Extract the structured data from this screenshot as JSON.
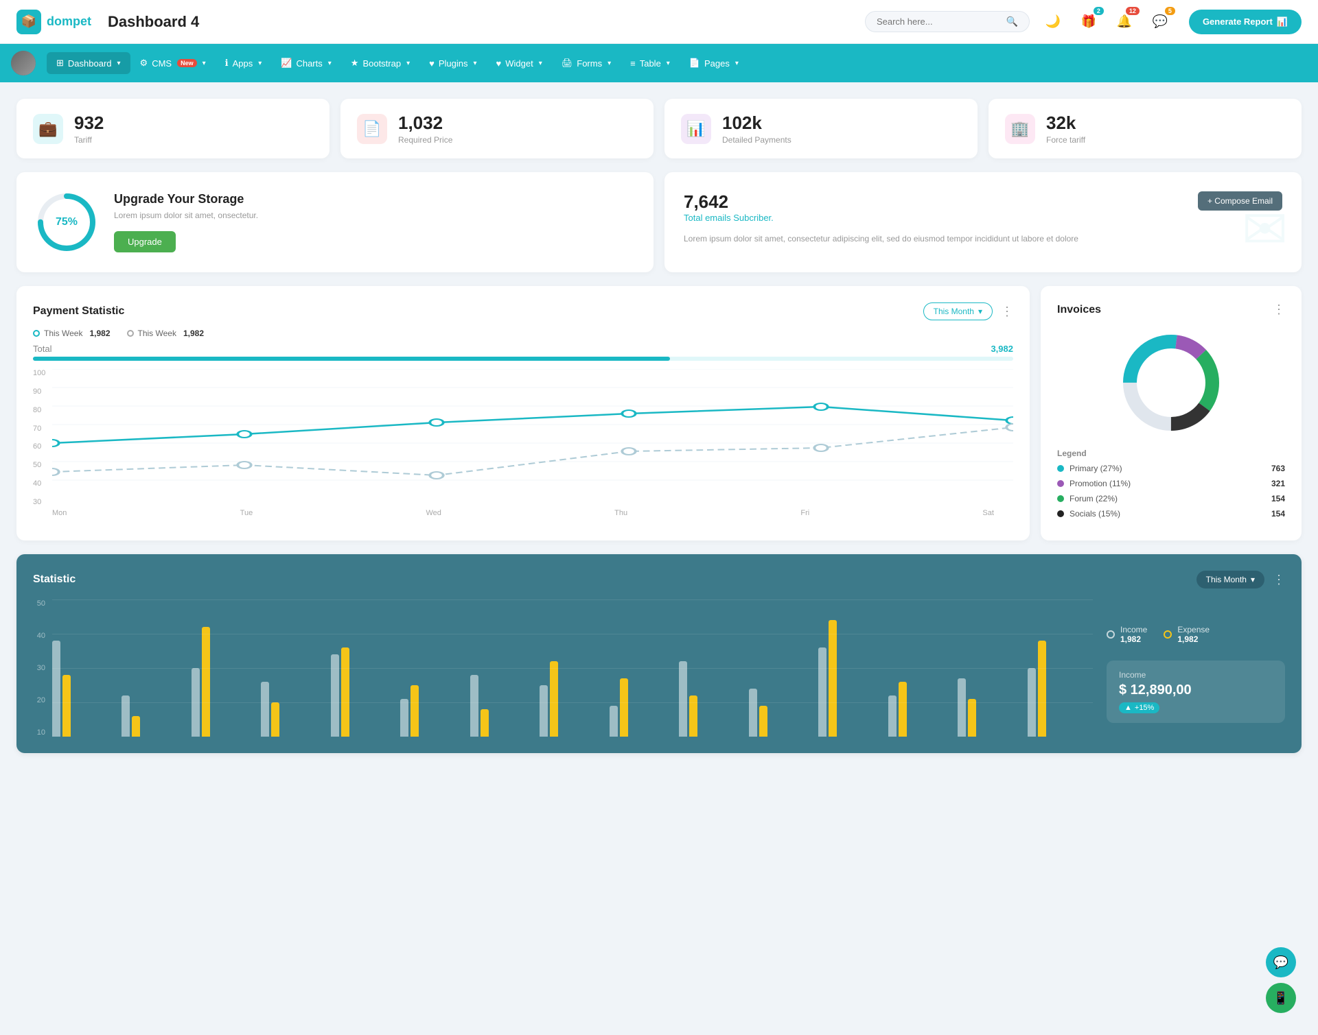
{
  "header": {
    "logo_text": "dompet",
    "page_title": "Dashboard 4",
    "search_placeholder": "Search here...",
    "generate_btn": "Generate Report",
    "icons": {
      "gift_badge": "2",
      "bell_badge": "12",
      "chat_badge": "5"
    }
  },
  "nav": {
    "items": [
      {
        "label": "Dashboard",
        "active": true,
        "has_dropdown": true
      },
      {
        "label": "CMS",
        "active": false,
        "has_dropdown": true,
        "badge_new": true
      },
      {
        "label": "Apps",
        "active": false,
        "has_dropdown": true
      },
      {
        "label": "Charts",
        "active": false,
        "has_dropdown": true
      },
      {
        "label": "Bootstrap",
        "active": false,
        "has_dropdown": true
      },
      {
        "label": "Plugins",
        "active": false,
        "has_dropdown": true
      },
      {
        "label": "Widget",
        "active": false,
        "has_dropdown": true
      },
      {
        "label": "Forms",
        "active": false,
        "has_dropdown": true
      },
      {
        "label": "Table",
        "active": false,
        "has_dropdown": true
      },
      {
        "label": "Pages",
        "active": false,
        "has_dropdown": true
      }
    ]
  },
  "stat_cards": [
    {
      "value": "932",
      "label": "Tariff",
      "icon": "briefcase",
      "color": "teal"
    },
    {
      "value": "1,032",
      "label": "Required Price",
      "icon": "document",
      "color": "red"
    },
    {
      "value": "102k",
      "label": "Detailed Payments",
      "icon": "chart",
      "color": "purple"
    },
    {
      "value": "32k",
      "label": "Force tariff",
      "icon": "building",
      "color": "pink"
    }
  ],
  "storage": {
    "percent": 75,
    "title": "Upgrade Your Storage",
    "description": "Lorem ipsum dolor sit amet, onsectetur.",
    "btn_label": "Upgrade"
  },
  "email": {
    "count": "7,642",
    "subtitle": "Total emails Subcriber.",
    "description": "Lorem ipsum dolor sit amet, consectetur adipiscing elit, sed do eiusmod tempor incididunt ut labore et dolore",
    "compose_btn": "+ Compose Email"
  },
  "payment": {
    "title": "Payment Statistic",
    "filter_label": "This Month",
    "legend1_label": "This Week",
    "legend1_value": "1,982",
    "legend2_label": "This Week",
    "legend2_value": "1,982",
    "total_label": "Total",
    "total_value": "3,982",
    "y_labels": [
      "100",
      "90",
      "80",
      "70",
      "60",
      "50",
      "40",
      "30"
    ],
    "x_labels": [
      "Mon",
      "Tue",
      "Wed",
      "Thu",
      "Fri",
      "Sat"
    ],
    "line1_points": "0,130 120,120 240,110 360,100 480,105 600,80",
    "line2_points": "0,155 120,150 240,148 360,145 480,150 600,115"
  },
  "invoices": {
    "title": "Invoices",
    "legend": [
      {
        "label": "Primary (27%)",
        "value": "763",
        "color": "#1ab8c4"
      },
      {
        "label": "Promotion (11%)",
        "value": "321",
        "color": "#9b59b6"
      },
      {
        "label": "Forum (22%)",
        "value": "154",
        "color": "#27ae60"
      },
      {
        "label": "Socials (15%)",
        "value": "154",
        "color": "#222"
      }
    ],
    "donut": {
      "segments": [
        {
          "pct": 27,
          "color": "#1ab8c4"
        },
        {
          "pct": 11,
          "color": "#9b59b6"
        },
        {
          "pct": 22,
          "color": "#27ae60"
        },
        {
          "pct": 15,
          "color": "#222"
        },
        {
          "pct": 25,
          "color": "#e0e6ed"
        }
      ]
    }
  },
  "statistic": {
    "title": "Statistic",
    "filter_label": "This Month",
    "income_label": "Income",
    "income_value": "1,982",
    "expense_label": "Expense",
    "expense_value": "1,982",
    "income_box_title": "Income",
    "income_box_value": "$ 12,890,00",
    "income_box_badge": "+15%",
    "y_labels": [
      "50",
      "40",
      "30",
      "20",
      "10"
    ],
    "bars": [
      {
        "white": 140,
        "yellow": 90
      },
      {
        "white": 60,
        "yellow": 30
      },
      {
        "white": 100,
        "yellow": 160
      },
      {
        "white": 80,
        "yellow": 50
      },
      {
        "white": 120,
        "yellow": 130
      },
      {
        "white": 55,
        "yellow": 75
      },
      {
        "white": 90,
        "yellow": 40
      },
      {
        "white": 75,
        "yellow": 110
      },
      {
        "white": 45,
        "yellow": 85
      },
      {
        "white": 110,
        "yellow": 60
      },
      {
        "white": 70,
        "yellow": 45
      },
      {
        "white": 130,
        "yellow": 170
      },
      {
        "white": 60,
        "yellow": 80
      },
      {
        "white": 85,
        "yellow": 55
      },
      {
        "white": 100,
        "yellow": 140
      }
    ]
  }
}
